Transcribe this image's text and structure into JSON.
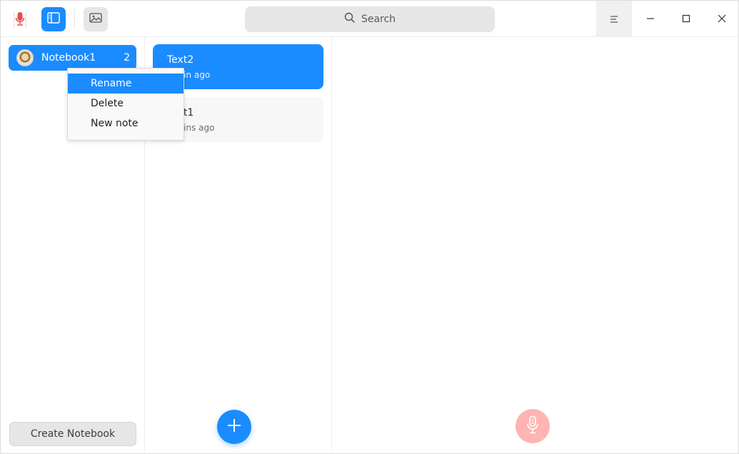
{
  "titlebar": {
    "search_placeholder": "Search",
    "icons": {
      "app": "microphone-app-icon",
      "sidebar_toggle": "sidebar-toggle-icon",
      "image": "image-icon",
      "search": "search-icon",
      "menu": "hamburger-menu-icon",
      "minimize": "minimize-icon",
      "maximize": "maximize-icon",
      "close": "close-icon"
    }
  },
  "sidebar": {
    "notebooks": [
      {
        "label": "Notebook1",
        "count": "2",
        "selected": true
      }
    ],
    "create_button": "Create Notebook"
  },
  "context_menu": {
    "items": [
      {
        "label": "Rename",
        "highlighted": true
      },
      {
        "label": "Delete",
        "highlighted": false
      },
      {
        "label": "New note",
        "highlighted": false
      }
    ]
  },
  "notes": [
    {
      "title": "Text2",
      "time": "1 min ago",
      "selected": true
    },
    {
      "title": "Text1",
      "time": "2 mins ago",
      "selected": false
    }
  ],
  "colors": {
    "accent": "#1a8cff",
    "record_button": "#ffb3b3",
    "search_bg": "#e6e6e6"
  }
}
